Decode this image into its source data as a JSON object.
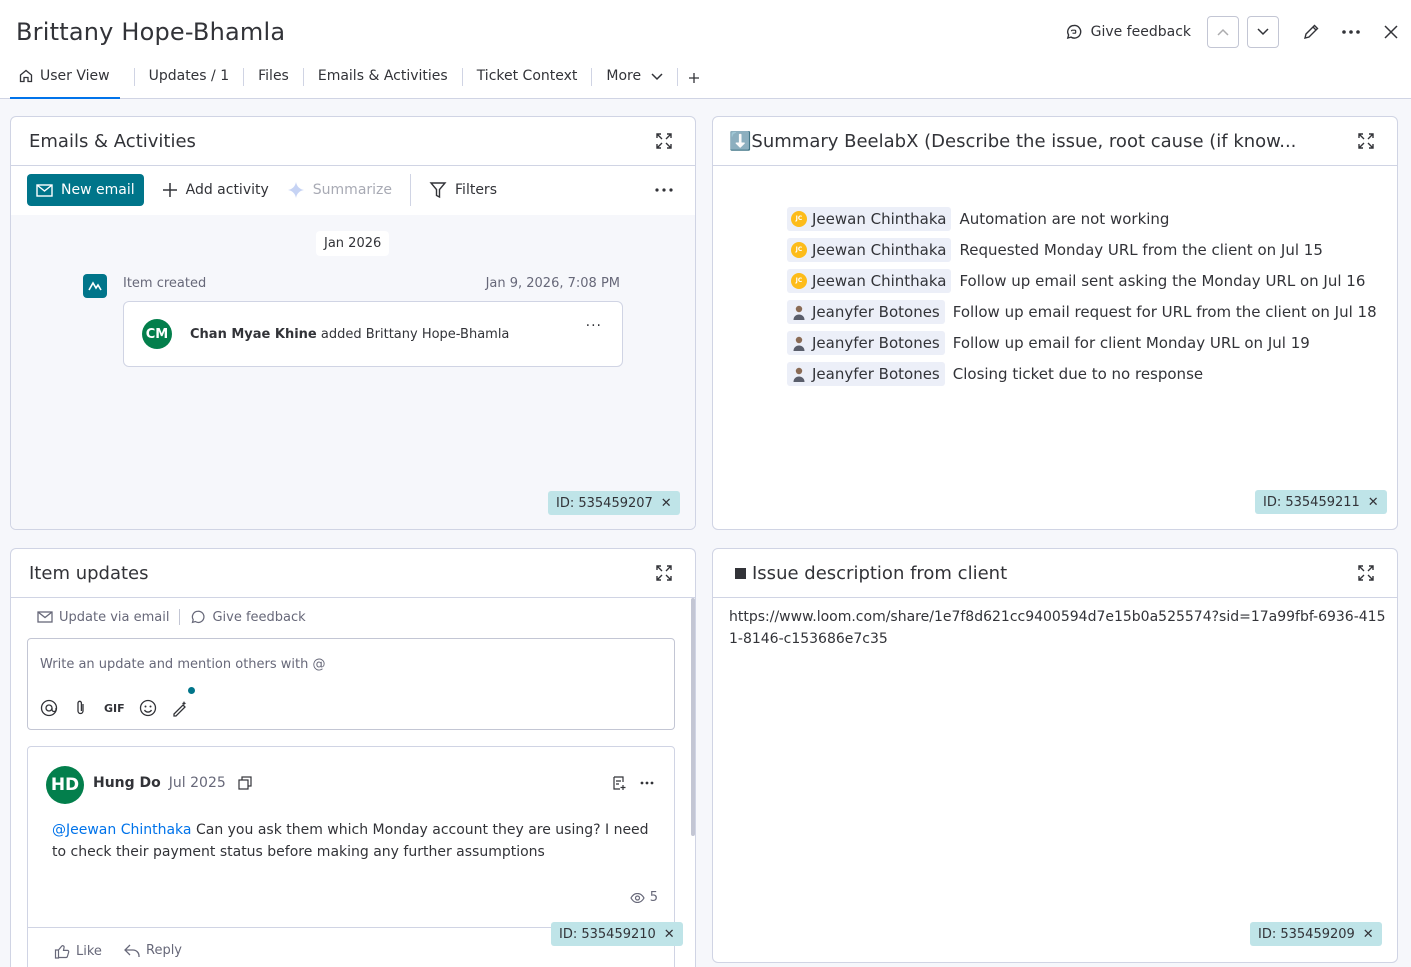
{
  "header": {
    "title": "Brittany Hope-Bhamla",
    "give_feedback": "Give feedback"
  },
  "tabs": [
    {
      "label": "User View"
    },
    {
      "label": "Updates / 1"
    },
    {
      "label": "Files"
    },
    {
      "label": "Emails & Activities"
    },
    {
      "label": "Ticket Context"
    },
    {
      "label": "More"
    }
  ],
  "emails": {
    "title": "Emails & Activities",
    "new_email": "New email",
    "add_activity": "Add activity",
    "summarize": "Summarize",
    "filters": "Filters",
    "date_group": "Jan 2026",
    "activity_label": "Item created",
    "activity_time": "Jan 9, 2026, 7:08 PM",
    "activity_avatar": "CM",
    "activity_actor": "Chan Myae Khine",
    "activity_text": "added Brittany Hope-Bhamla",
    "id": "ID: 535459207"
  },
  "summary": {
    "title": "⬇️Summary BeelabX (Describe the issue, root cause (if know...",
    "rows": [
      {
        "person": "Jeewan Chinthaka",
        "text": "Automation are not working",
        "avatar": "JC"
      },
      {
        "person": "Jeewan Chinthaka",
        "text": "Requested Monday URL from the client on Jul 15",
        "avatar": "JC"
      },
      {
        "person": "Jeewan Chinthaka",
        "text": "Follow up email sent asking the Monday URL on Jul 16",
        "avatar": "JC"
      },
      {
        "person": "Jeanyfer Botones",
        "text": "Follow up email request for URL from the client on Jul 18",
        "avatar": "person"
      },
      {
        "person": "Jeanyfer Botones",
        "text": "Follow up email for client Monday URL on Jul 19",
        "avatar": "person"
      },
      {
        "person": "Jeanyfer Botones",
        "text": "Closing ticket due to no response",
        "avatar": "person"
      }
    ],
    "id": "ID: 535459211"
  },
  "updates": {
    "title": "Item updates",
    "update_via_email": "Update via email",
    "give_feedback": "Give feedback",
    "composer_placeholder": "Write an update and mention others with @",
    "gif": "GIF",
    "post_avatar": "HD",
    "post_author": "Hung Do",
    "post_date": "Jul 2025",
    "post_mention": "@Jeewan Chinthaka",
    "post_text": " Can you ask them which Monday account they are using? I need to check their payment status before making any further assumptions",
    "views": "5",
    "like": "Like",
    "reply": "Reply",
    "id": "ID: 535459210"
  },
  "issue": {
    "title": "Issue description from client",
    "text": "https://www.loom.com/share/1e7f8d621cc9400594d7e15b0a525574?sid=17a99fbf-6936-4151-8146-c153686e7c35",
    "id": "ID: 535459209"
  },
  "colors": {
    "primary_teal": "#00758a",
    "id_tag_bg": "#bfe4e8",
    "avatar_green": "#037f4c",
    "jc_yellow": "#fdbc1a",
    "link_blue": "#0073ea"
  }
}
